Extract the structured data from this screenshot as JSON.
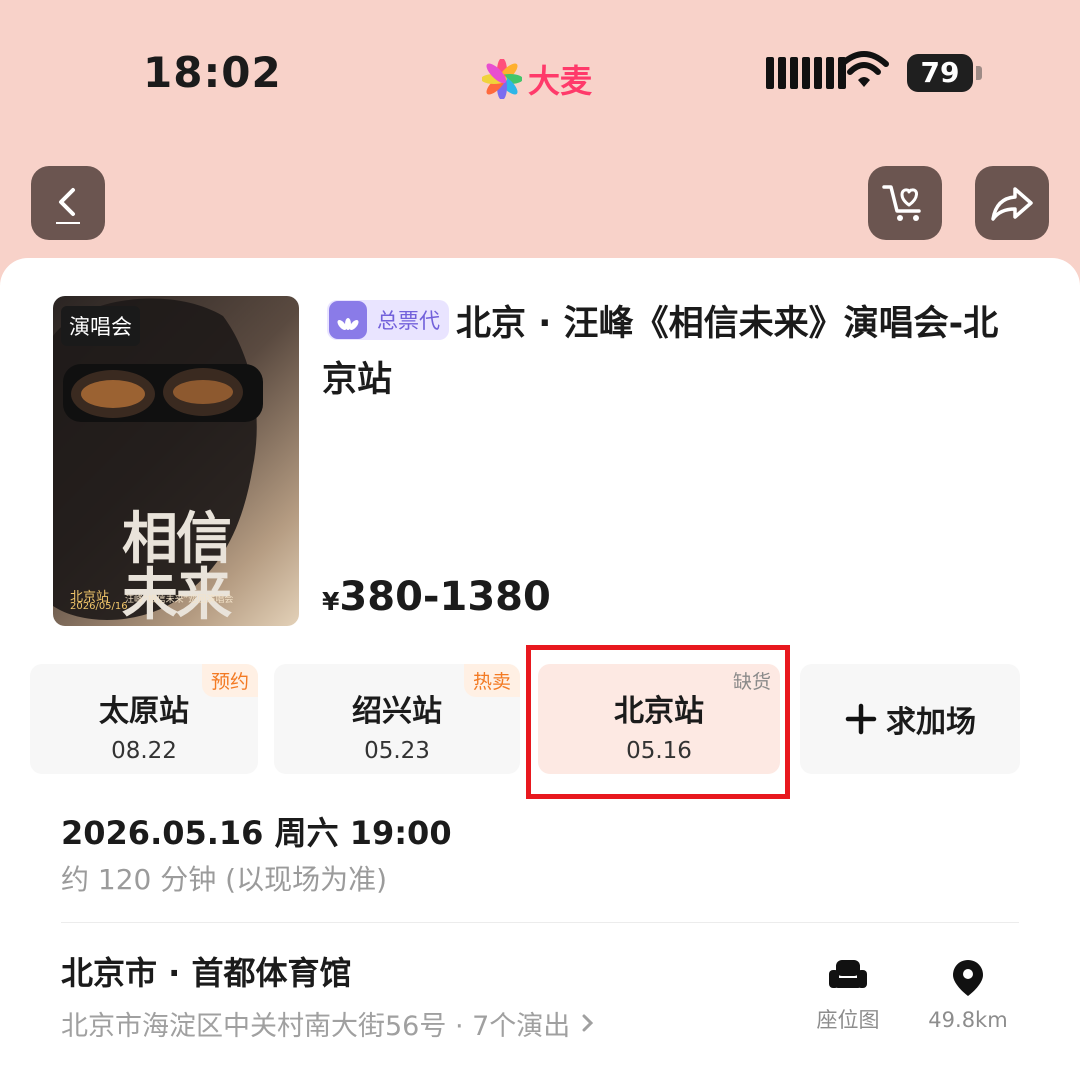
{
  "status_bar": {
    "time": "18:02",
    "app_name": "大麦",
    "battery": "79"
  },
  "nav": {
    "back_icon": "chevron-left-icon",
    "cart_icon": "cart-heart-icon",
    "share_icon": "share-arrow-icon"
  },
  "event": {
    "poster_tag": "演唱会",
    "poster_title_line1": "相信",
    "poster_title_line2": "未来",
    "poster_city": "北京站",
    "poster_date": "2026/05/16",
    "poster_subtitle": "汪峰“相信未来”巡回演唱会",
    "agent_badge": "总票代",
    "title": "北京 · 汪峰《相信未来》演唱会-北京站",
    "price_currency": "¥",
    "price_range": "380-1380"
  },
  "sessions": [
    {
      "city": "太原站",
      "date": "08.22",
      "badge": "预约"
    },
    {
      "city": "绍兴站",
      "date": "05.23",
      "badge": "热卖"
    },
    {
      "city": "北京站",
      "date": "05.16",
      "badge": "缺货"
    }
  ],
  "add_session_label": "求加场",
  "show": {
    "datetime": "2026.05.16 周六 19:00",
    "duration": "约 120 分钟 (以现场为准)"
  },
  "venue": {
    "name": "北京市 · 首都体育馆",
    "address": "北京市海淀区中关村南大街56号 · 7个演出",
    "seat_map_label": "座位图",
    "distance": "49.8km"
  },
  "colors": {
    "header_bg": "#f8d2c9",
    "brand": "#ff3a6a",
    "selected_tab_bg": "#fde9e3",
    "highlight_border": "#e8181e",
    "agent_purple": "#7261db"
  }
}
